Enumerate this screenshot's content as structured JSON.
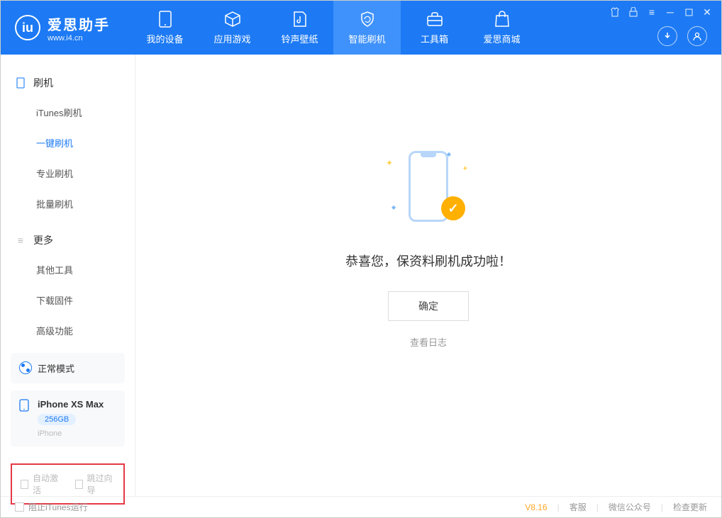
{
  "app": {
    "title": "爱思助手",
    "url": "www.i4.cn"
  },
  "nav": {
    "items": [
      {
        "label": "我的设备"
      },
      {
        "label": "应用游戏"
      },
      {
        "label": "铃声壁纸"
      },
      {
        "label": "智能刷机"
      },
      {
        "label": "工具箱"
      },
      {
        "label": "爱思商城"
      }
    ]
  },
  "sidebar": {
    "section1": {
      "title": "刷机",
      "items": [
        "iTunes刷机",
        "一键刷机",
        "专业刷机",
        "批量刷机"
      ]
    },
    "section2": {
      "title": "更多",
      "items": [
        "其他工具",
        "下载固件",
        "高级功能"
      ]
    }
  },
  "device": {
    "mode": "正常模式",
    "name": "iPhone XS Max",
    "storage": "256GB",
    "type": "iPhone"
  },
  "options": {
    "auto_activate": "自动激活",
    "skip_guide": "跳过向导"
  },
  "main": {
    "success_text": "恭喜您，保资料刷机成功啦！",
    "confirm": "确定",
    "view_log": "查看日志"
  },
  "statusbar": {
    "block_itunes": "阻止iTunes运行",
    "version": "V8.16",
    "support": "客服",
    "wechat": "微信公众号",
    "update": "检查更新"
  }
}
